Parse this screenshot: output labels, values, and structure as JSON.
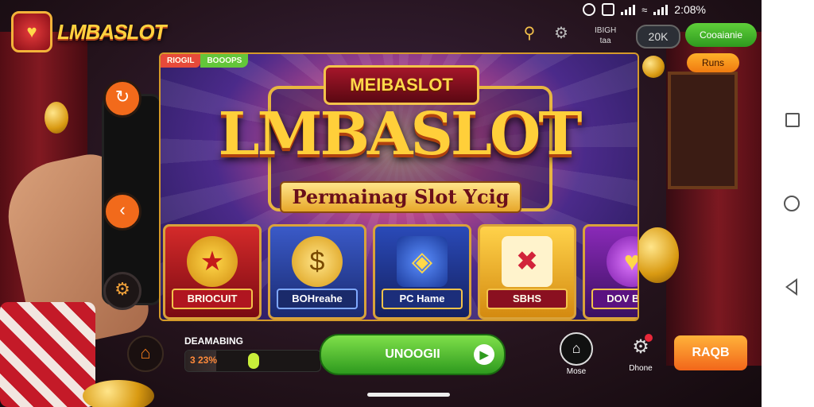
{
  "status_bar": {
    "time": "2:08%"
  },
  "brand": {
    "name": "LMBASLOT"
  },
  "top_bar": {
    "mini_label_line1": "IBIGH",
    "mini_label_line2": "taa",
    "balance": "20K",
    "green_pill": "Cooaianie",
    "orange_pill": "Runs"
  },
  "banner": {
    "tag_left": "RIOGIL",
    "tag_right": "BOOOPS",
    "crest": "MEIBASLOT",
    "title": "LMBASLOT",
    "subtitle": "Permainag Slot Ycig"
  },
  "cards": [
    {
      "label": "BRIOCUIT",
      "icon": "star-emblem-icon"
    },
    {
      "label": "BOHreahe",
      "icon": "gold-coin-icon"
    },
    {
      "label": "PC Hame",
      "icon": "shield-badge-icon"
    },
    {
      "label": "SBHS",
      "icon": "slot-reel-icon"
    },
    {
      "label": "DOV Boail",
      "icon": "heart-gem-icon"
    }
  ],
  "bottom_bar": {
    "progress_label": "DEAMABING",
    "progress_value": "3 23%",
    "progress_fraction": 0.23,
    "cta_label": "UNOOGII",
    "nav": [
      {
        "label": "Mose",
        "icon": "home-icon"
      },
      {
        "label": "Dhone",
        "icon": "gear-icon"
      }
    ],
    "orange_button": "RAQB"
  },
  "colors": {
    "accent": "#f26a1b",
    "gold": "#ffd23f",
    "green": "#2e9a1e"
  }
}
